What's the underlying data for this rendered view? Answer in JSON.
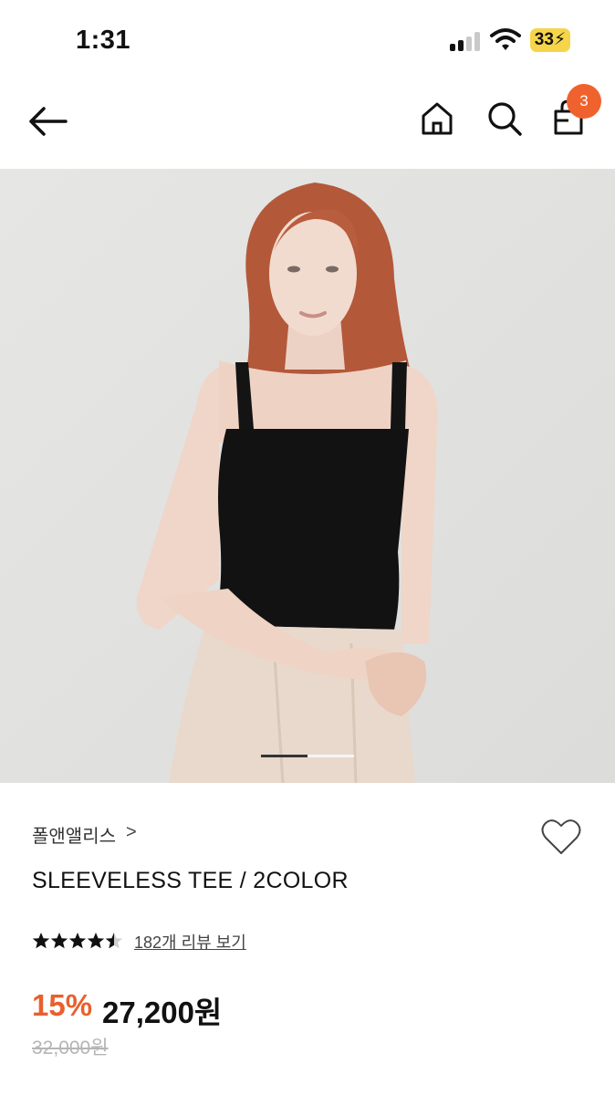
{
  "status_bar": {
    "time": "1:31",
    "battery": "33"
  },
  "nav": {
    "cart_count": "3"
  },
  "hero": {
    "carousel_index": 1,
    "carousel_total": 2
  },
  "product": {
    "brand": "폴앤앨리스",
    "brand_chevron": ">",
    "title": "SLEEVELESS TEE / 2COLOR",
    "rating": 4.5,
    "review_link": "182개 리뷰 보기",
    "discount": "15%",
    "price": "27,200원",
    "original_price": "32,000원"
  },
  "colors": {
    "accent": "#f0622d",
    "discount": "#e8602d"
  }
}
